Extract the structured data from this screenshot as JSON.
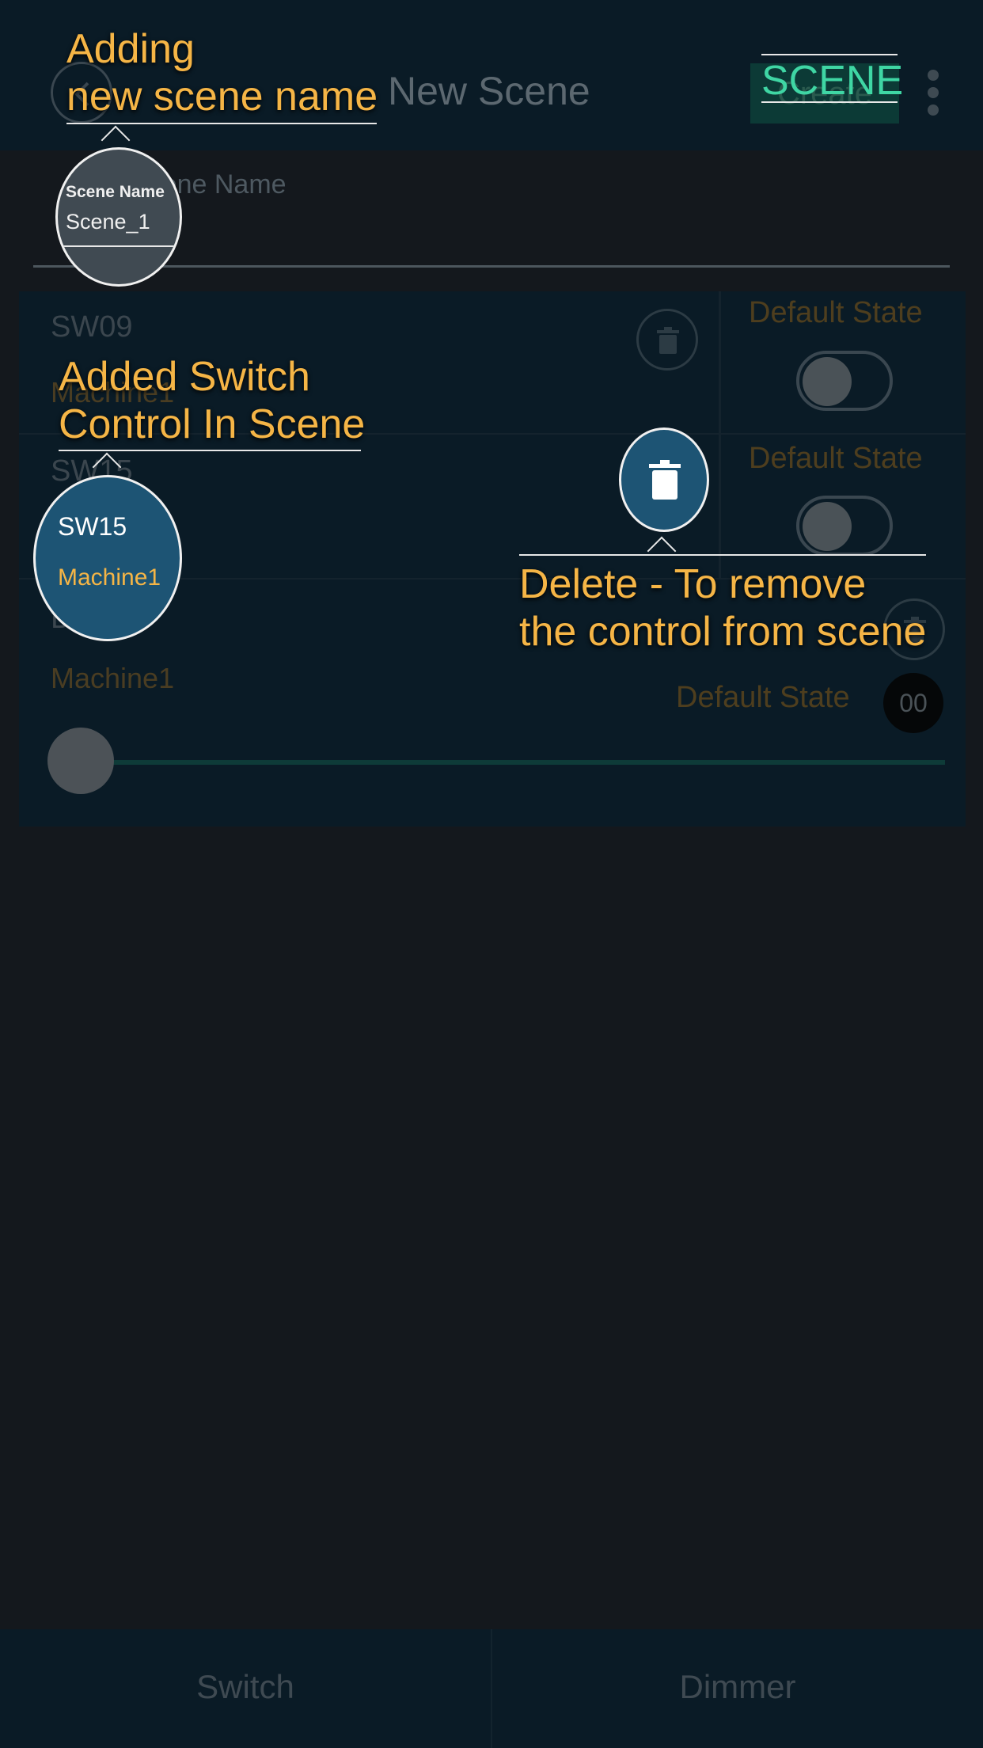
{
  "header": {
    "title": "New Scene",
    "create_label": "Create"
  },
  "scene_name": {
    "label": "Scene Name",
    "value": "Scene_1"
  },
  "controls": [
    {
      "id": "SW09",
      "location": "Machine1",
      "default_state_label": "Default State",
      "state": "off"
    },
    {
      "id": "SW15",
      "location": "Machine1",
      "default_state_label": "Default State",
      "state": "off"
    },
    {
      "id": "D",
      "location": "Machine1",
      "default_state_label": "Default State",
      "value": "00"
    }
  ],
  "bottom_tabs": [
    "Switch",
    "Dimmer"
  ],
  "tutorial": {
    "scene_tag": "SCENE",
    "tip_name_line1": "Adding",
    "tip_name_line2": "new scene name",
    "tip_switch_line1": "Added Switch",
    "tip_switch_line2": "Control In Scene",
    "tip_delete_line1": "Delete - To remove",
    "tip_delete_line2": "the control from scene",
    "bubble_name_label": "Scene Name",
    "bubble_name_value": "Scene_1",
    "bubble_switch_id": "SW15",
    "bubble_switch_location": "Machine1"
  },
  "colors": {
    "background": "#14181d",
    "header": "#0a1b26",
    "accent_green": "#3fd6a4",
    "tip_orange": "#f5b546",
    "bubble_blue": "#1d5474"
  }
}
